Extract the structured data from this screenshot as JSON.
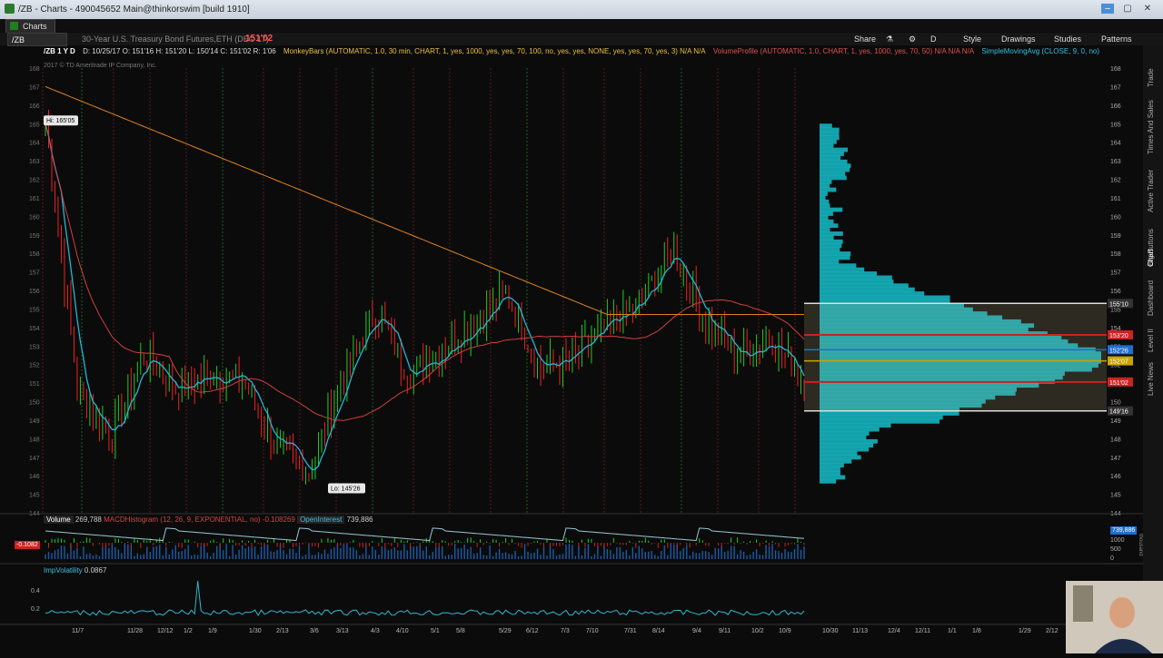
{
  "window": {
    "title": "/ZB - Charts - 490045652 Main@thinkorswim [build 1910]"
  },
  "tab": {
    "label": "Charts"
  },
  "toolbar": {
    "symbol": "/ZB",
    "description": "30-Year U.S. Treasury Bond Futures,ETH (DEC 17)",
    "last_price": "151'02",
    "share": "Share",
    "style": "Style",
    "drawings": "Drawings",
    "studies": "Studies",
    "patterns": "Patterns",
    "d_label": "D"
  },
  "infobar": {
    "period": "/ZB 1 Y D",
    "ohlc": "D: 10/25/17  O: 151'16  H: 151'20  L: 150'14  C: 151'02  R: 1'06",
    "monkeybars": "MonkeyBars (AUTOMATIC, 1.0, 30 min, CHART, 1, yes, 1000, yes, yes, 70, 100, no, yes, yes, NONE, yes, yes, 70, yes, 3)  N/A  N/A",
    "volumeprofile": "VolumeProfile (AUTOMATIC, 1.0, CHART, 1, yes, 1000, yes, 70, 50)  N/A  N/A  N/A",
    "sma": "SimpleMovingAvg (CLOSE, 9, 0, no)",
    "copyright": "2017 © TD Ameritrade IP Company, Inc."
  },
  "annotations": {
    "hi": "Hi: 165'05",
    "lo": "Lo: 145'26"
  },
  "price_labels": [
    {
      "text": "155'10",
      "bg": "#333333",
      "price": 155.3
    },
    {
      "text": "153'20",
      "bg": "#cc2222",
      "price": 153.6
    },
    {
      "text": "152'26",
      "bg": "#1d6fd1",
      "price": 152.8
    },
    {
      "text": "152'07",
      "bg": "#c9a400",
      "price": 152.2
    },
    {
      "text": "151'02",
      "bg": "#cc2222",
      "price": 151.06
    },
    {
      "text": "149'16",
      "bg": "#333333",
      "price": 149.5
    }
  ],
  "volume_panel": {
    "volume_label": "Volume",
    "volume_value": "269,788",
    "macd_label": "MACDHistogram (12, 26, 9, EXPONENTIAL, no)",
    "macd_value": "-0.108269",
    "oi_label": "OpenInterest",
    "oi_value": "739,886",
    "left_badge": "-0.1082",
    "right_badge": "739,886",
    "scale": [
      "1000",
      "500",
      "0"
    ],
    "units": "thousand"
  },
  "impvol_panel": {
    "label": "ImpVolatility",
    "value": "0.0867",
    "scale": [
      "0.4",
      "0.2"
    ]
  },
  "sidebar": [
    "Trade",
    "Times And Sales",
    "Active Trader",
    "Big Buttons",
    "Chart",
    "Dashboard",
    "Level II",
    "Live News"
  ],
  "colors": {
    "bg": "#0b0b0b",
    "up": "#22cc22",
    "down": "#ee2222",
    "sma9": "#20b8d8",
    "ma_orange": "#e08020",
    "ma_red": "#d04040",
    "profile": "#15bcc8"
  },
  "chart_data": {
    "type": "line",
    "ylim": [
      144,
      168
    ],
    "y_ticks": [
      "168",
      "167",
      "166",
      "165",
      "164",
      "163",
      "162",
      "161",
      "160",
      "159",
      "158",
      "157",
      "156",
      "155",
      "154",
      "153",
      "152",
      "151",
      "150",
      "149",
      "148",
      "147",
      "146",
      "145",
      "144"
    ],
    "x_ticks": [
      "11/7",
      "11/28",
      "12/12",
      "1/2",
      "1/9",
      "1/30",
      "2/13",
      "3/6",
      "3/13",
      "4/3",
      "4/10",
      "5/1",
      "5/8",
      "5/29",
      "6/12",
      "7/3",
      "7/10",
      "7/31",
      "8/14",
      "9/4",
      "9/11",
      "10/2",
      "10/9",
      "10/30",
      "11/13",
      "12/4",
      "12/11",
      "1/1",
      "1/8",
      "1/29",
      "2/12"
    ],
    "series": [
      {
        "dates": [
          "11/7",
          "11/28",
          "12/12",
          "1/2",
          "1/9",
          "1/30",
          "2/13",
          "3/6",
          "3/13",
          "4/3",
          "4/10",
          "5/1",
          "5/8",
          "5/29",
          "6/12",
          "7/3",
          "7/10",
          "7/31",
          "8/14",
          "9/4",
          "9/11",
          "10/2",
          "10/9",
          "10/25"
        ],
        "close": [
          165,
          150.5,
          148.2,
          152.6,
          150.6,
          151.5,
          151.2,
          147.5,
          146.3,
          151.2,
          155.0,
          151.5,
          152.8,
          154.3,
          155.8,
          151.8,
          152.3,
          154.0,
          155.2,
          158.2,
          154.5,
          152.4,
          153.5,
          151.06
        ]
      }
    ]
  }
}
